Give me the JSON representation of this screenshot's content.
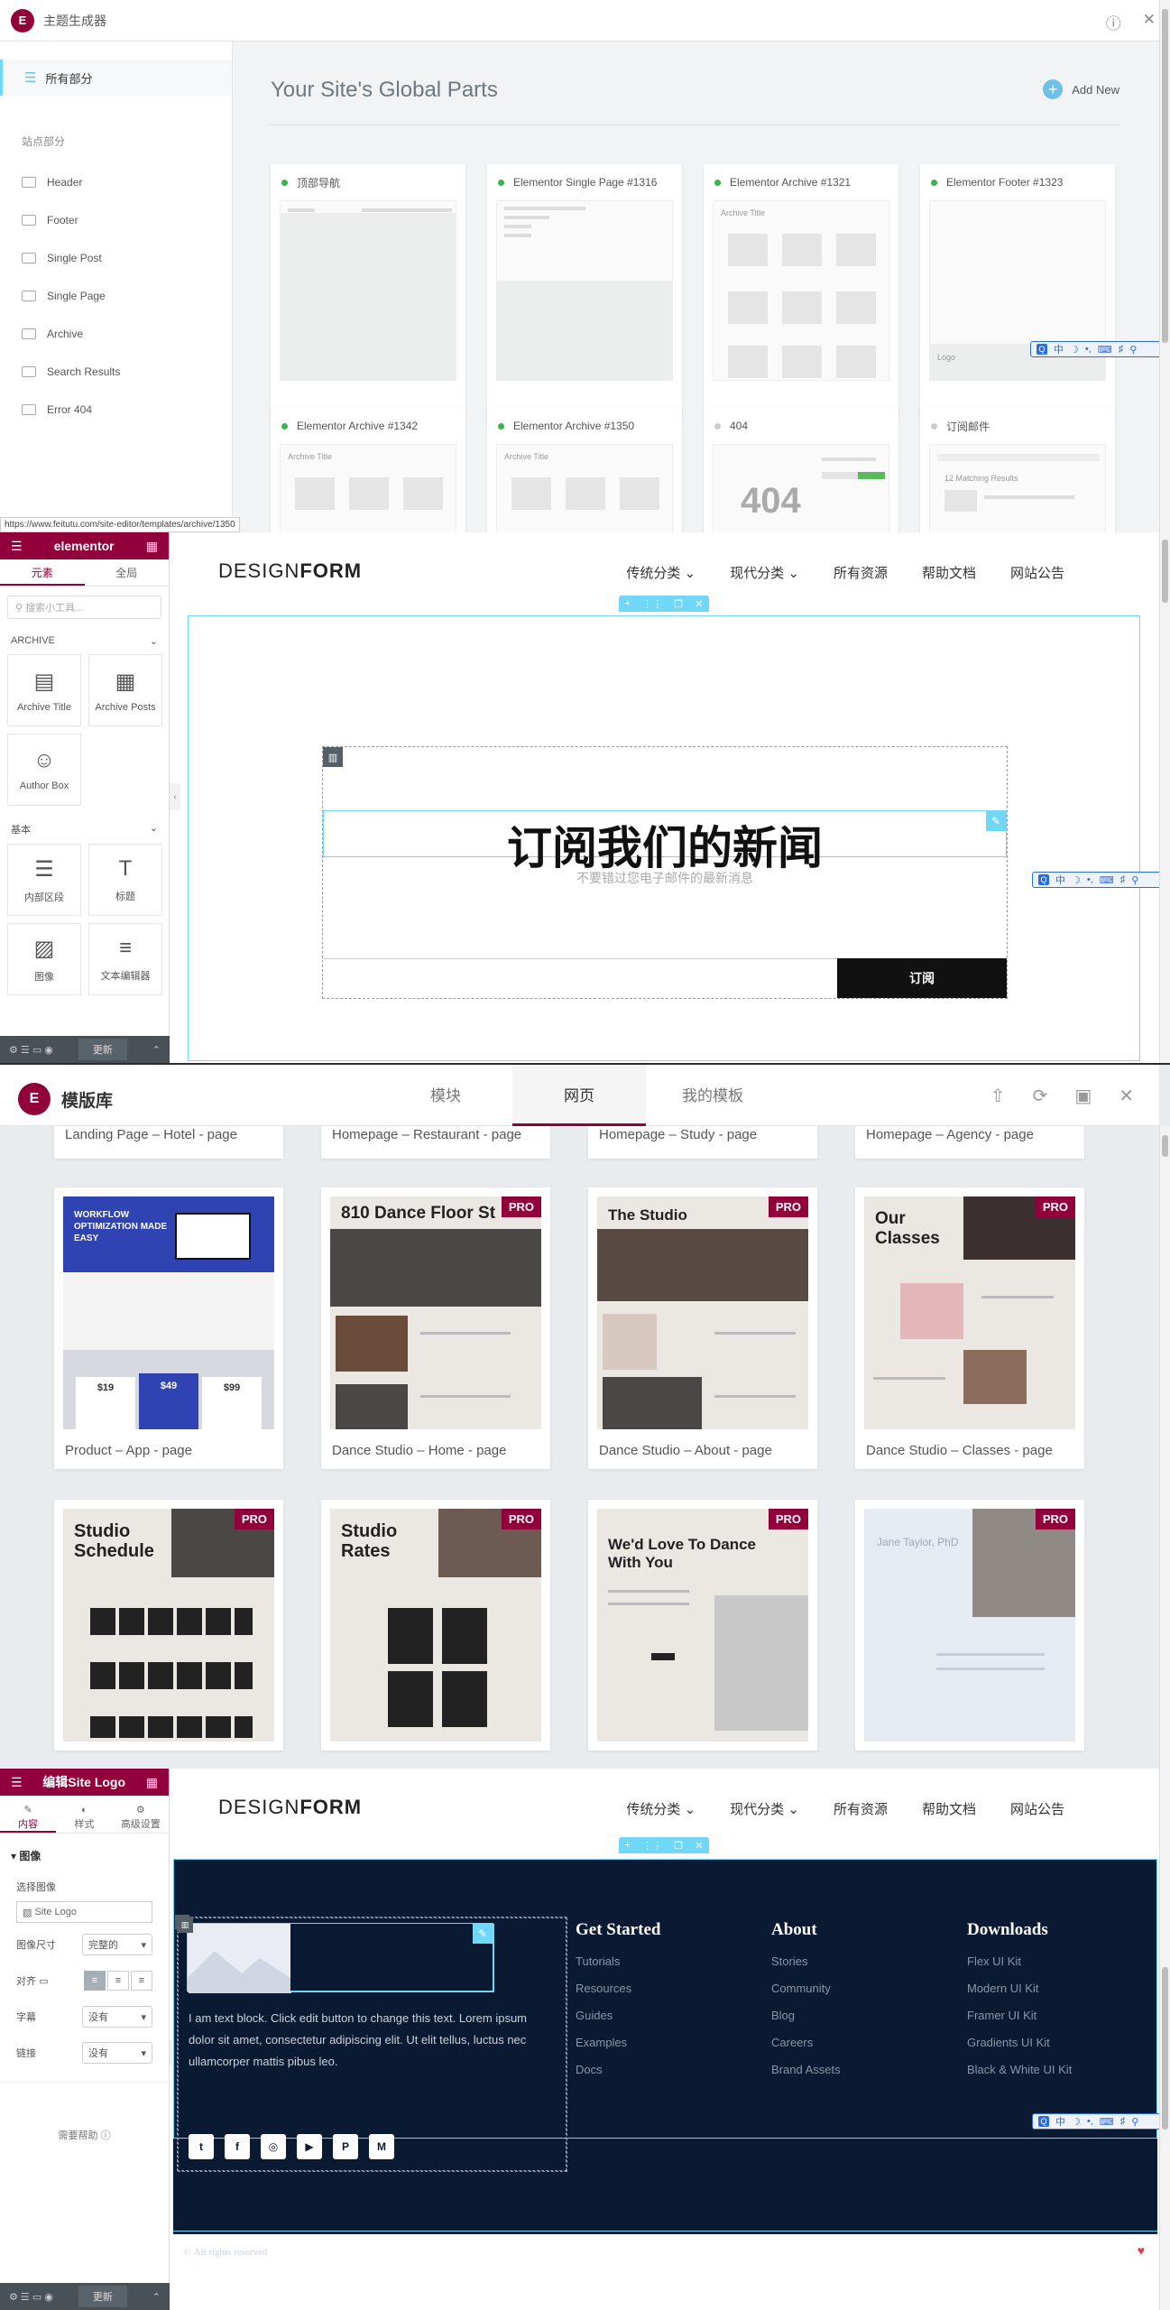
{
  "pane1": {
    "app_title": "主题生成器",
    "info_icon": "ⓘ",
    "close_icon": "✕",
    "sidebar_all": "所有部分",
    "sidebar_section": "站点部分",
    "sidebar_items": [
      "Header",
      "Footer",
      "Single Post",
      "Single Page",
      "Archive",
      "Search Results",
      "Error 404"
    ],
    "heading": "Your Site's Global Parts",
    "add_new": "Add New",
    "cards": [
      {
        "title": "顶部导航",
        "status": "green"
      },
      {
        "title": "Elementor Single Page #1316",
        "status": "green"
      },
      {
        "title": "Elementor Archive #1321",
        "status": "green"
      },
      {
        "title": "Elementor Footer #1323",
        "status": "green"
      },
      {
        "title": "Elementor Archive #1342",
        "status": "green"
      },
      {
        "title": "Elementor Archive #1350",
        "status": "green"
      },
      {
        "title": "404",
        "status": "gray"
      },
      {
        "title": "订阅邮件",
        "status": "gray"
      }
    ],
    "card_thumbs": {
      "archive_title": "Archive Title",
      "logo": "Logo",
      "big404": "404",
      "matching": "12 Matching Results"
    },
    "status_url": "https://www.feitutu.com/site-editor/templates/archive/1350"
  },
  "toolbar": {
    "items": [
      "Q",
      "中",
      "☽",
      "•,",
      "⌨",
      "♯",
      "⚲"
    ]
  },
  "editor": {
    "brand": "elementor",
    "tab_elements": "元素",
    "tab_global": "全局",
    "search_placeholder": "搜索小工具...",
    "group_archive": "ARCHIVE",
    "group_basic": "基本",
    "widgets_archive": [
      {
        "label": "Archive Title",
        "icon": "▤"
      },
      {
        "label": "Archive Posts",
        "icon": "▦"
      },
      {
        "label": "Author Box",
        "icon": "☺"
      }
    ],
    "widgets_basic": [
      {
        "label": "内部区段",
        "icon": "☰"
      },
      {
        "label": "标题",
        "icon": "T"
      },
      {
        "label": "图像",
        "icon": "▨"
      },
      {
        "label": "文本编辑器",
        "icon": "≡"
      }
    ],
    "update": "更新"
  },
  "site": {
    "logo_light": "DESIGN",
    "logo_bold": "FORM",
    "nav": [
      "传统分类",
      "现代分类",
      "所有资源",
      "帮助文档",
      "网站公告"
    ]
  },
  "newsletter": {
    "headline": "订阅我们的新闻",
    "subline": "不要错过您电子邮件的最新消息",
    "button": "订阅"
  },
  "library": {
    "title": "模版库",
    "tabs": [
      "模块",
      "网页",
      "我的模板"
    ],
    "top_row": [
      "Landing Page – Hotel - page",
      "Homepage – Restaurant - page",
      "Homepage – Study - page",
      "Homepage – Agency - page"
    ],
    "row2": [
      {
        "caption": "Product – App - page",
        "pro": false,
        "thumb_title": "WORKFLOW OPTIMIZATION MADE EASY"
      },
      {
        "caption": "Dance Studio – Home - page",
        "pro": true,
        "thumb_title": "810 Dance Floor St"
      },
      {
        "caption": "Dance Studio – About - page",
        "pro": true,
        "thumb_title": "The Studio"
      },
      {
        "caption": "Dance Studio – Classes - page",
        "pro": true,
        "thumb_title": "Our Classes"
      }
    ],
    "row3": [
      {
        "pro": true,
        "thumb_title": "Studio Schedule"
      },
      {
        "pro": true,
        "thumb_title": "Studio Rates"
      },
      {
        "pro": true,
        "thumb_title": "We'd Love To Dance With You"
      },
      {
        "pro": true,
        "thumb_title": "Jane Taylor, PhD"
      }
    ],
    "pro_label": "PRO",
    "prices": [
      "$19",
      "$49",
      "$99"
    ]
  },
  "logo_editor": {
    "title": "编辑Site Logo",
    "tabs": [
      "内容",
      "样式",
      "高级设置"
    ],
    "section": "图像",
    "choose_image": "选择图像",
    "site_logo": "Site Logo",
    "size_label": "图像尺寸",
    "size_value": "完整的",
    "align_label": "对齐",
    "caption_label": "字幕",
    "caption_value": "没有",
    "link_label": "链接",
    "link_value": "没有",
    "help": "需要帮助",
    "update": "更新"
  },
  "footer": {
    "text": "I am text block. Click edit button to change this text. Lorem ipsum dolor sit amet, consectetur adipiscing elit. Ut elit tellus, luctus nec ullamcorper mattis pibus leo.",
    "social": [
      "t",
      "f",
      "◎",
      "▶",
      "P",
      "M"
    ],
    "columns": [
      {
        "heading": "Get Started",
        "links": [
          "Tutorials",
          "Resources",
          "Guides",
          "Examples",
          "Docs"
        ]
      },
      {
        "heading": "About",
        "links": [
          "Stories",
          "Community",
          "Blog",
          "Careers",
          "Brand Assets"
        ]
      },
      {
        "heading": "Downloads",
        "links": [
          "Flex UI Kit",
          "Modern UI Kit",
          "Framer UI Kit",
          "Gradients UI Kit",
          "Black & White UI Kit"
        ]
      }
    ],
    "copyright": "© All rights reserved",
    "heart": "♥"
  },
  "colors": {
    "accent": "#92003b",
    "handle": "#71d7f7",
    "footer_bg": "#0a1a33"
  }
}
